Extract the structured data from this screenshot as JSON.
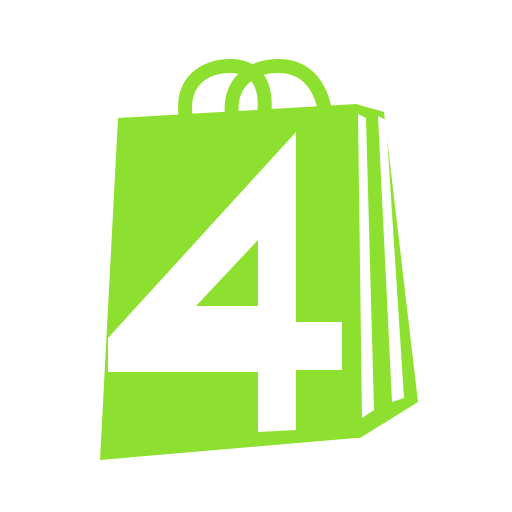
{
  "logo": {
    "name": "shopping-bag-4-logo",
    "glyph": "4",
    "colors": {
      "bag": "#8ee030",
      "glyph": "#ffffff",
      "background": "#ffffff"
    }
  }
}
